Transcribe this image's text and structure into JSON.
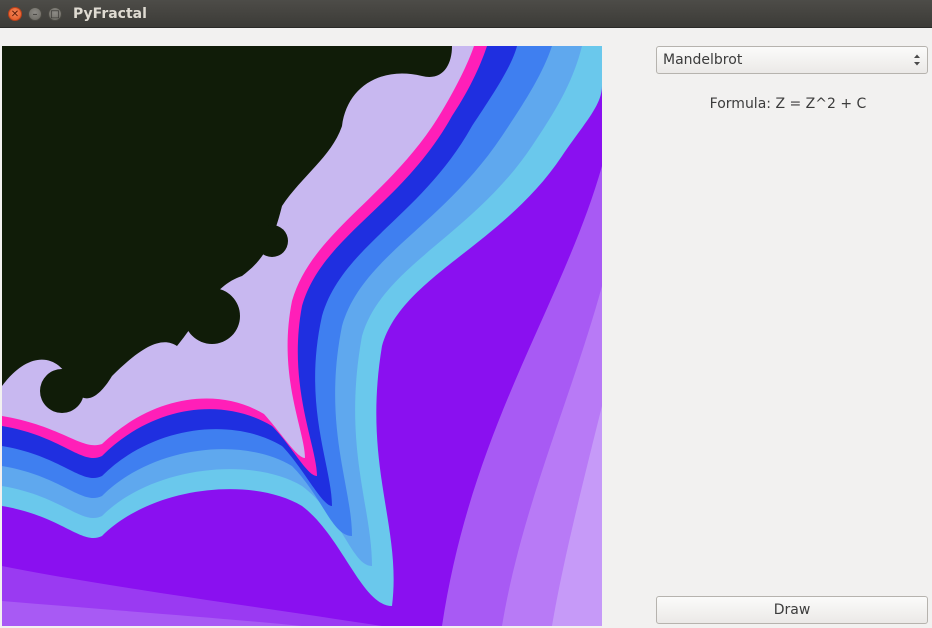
{
  "window": {
    "title": "PyFractal",
    "controls": [
      "close-icon",
      "minimize-icon",
      "maximize-icon"
    ]
  },
  "fractal_canvas": {
    "icon": "fractal-image",
    "colors": [
      "#101c08",
      "#c8b8f0",
      "#ff1fb8",
      "#1f2fe0",
      "#3f7ff0",
      "#5fa8ee",
      "#6ac8ec",
      "#8a10f0",
      "#9a3af2",
      "#a85af4",
      "#b87af6"
    ]
  },
  "fractal_selector": {
    "value": "Mandelbrot",
    "icon": "updown-arrows-icon"
  },
  "formula": {
    "text": "Formula: Z = Z^2 + C"
  },
  "draw_button": {
    "label": "Draw"
  }
}
